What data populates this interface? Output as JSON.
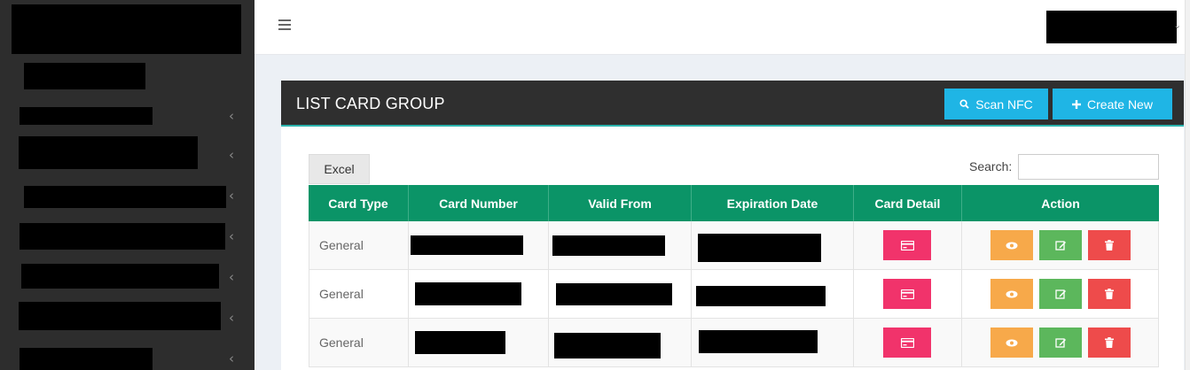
{
  "panel": {
    "title": "LIST CARD GROUP",
    "scan_label": "Scan NFC",
    "create_label": "Create New"
  },
  "toolbar": {
    "excel_label": "Excel",
    "search_label": "Search:",
    "search_value": ""
  },
  "table": {
    "headers": [
      "Card Type",
      "Card Number",
      "Valid From",
      "Expiration Date",
      "Card Detail",
      "Action"
    ],
    "rows": [
      {
        "card_type": "General"
      },
      {
        "card_type": "General"
      },
      {
        "card_type": "General"
      }
    ]
  },
  "icons": {
    "menu": "hamburger-icon",
    "search": "search-icon",
    "create": "plus-icon",
    "card_detail": "credit-card-icon",
    "view": "eye-icon",
    "edit": "edit-icon",
    "delete": "trash-icon",
    "nav_chevron": "chevron-left-icon",
    "user_menu": "chevron-down-icon"
  },
  "colors": {
    "sidebar": "#2d2d2d",
    "panel_header": "#2f2f2f",
    "header_accent": "#2bb3ad",
    "table_header": "#0b9467",
    "primary_button": "#1fb5e5",
    "card_detail_button": "#f1336b",
    "view_button": "#f7a94a",
    "edit_button": "#5cb75c",
    "delete_button": "#ee4b4b"
  }
}
